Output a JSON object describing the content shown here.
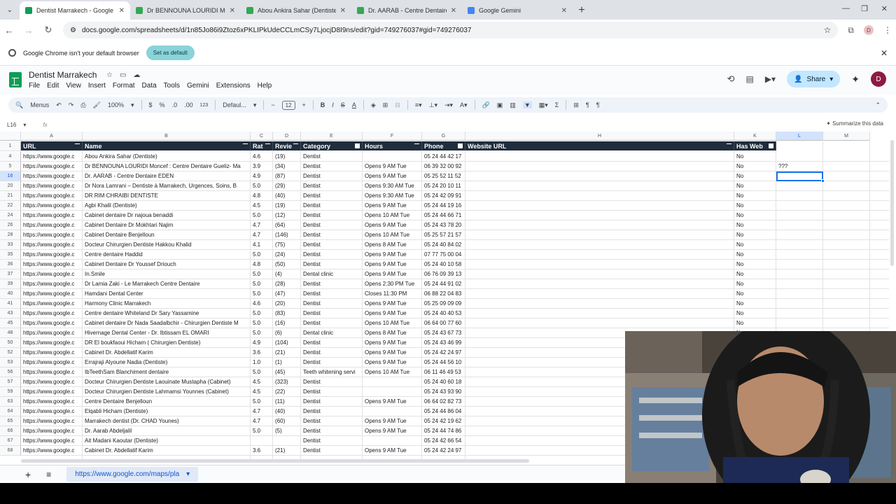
{
  "browser": {
    "tabs": [
      {
        "title": "Dentist Marrakech - Google Sh",
        "active": true,
        "favicon_color": "#0f9d58"
      },
      {
        "title": "Dr BENNOUNA LOURIDI Monc",
        "active": false,
        "favicon_color": "#34a853"
      },
      {
        "title": "Abou Ankira Sahar (Dentiste) -",
        "active": false,
        "favicon_color": "#34a853"
      },
      {
        "title": "Dr. AARAB - Centre Dentaire EI",
        "active": false,
        "favicon_color": "#34a853"
      },
      {
        "title": "Google Gemini",
        "active": false,
        "favicon_color": "#4285f4"
      }
    ],
    "url": "docs.google.com/spreadsheets/d/1n85Jo86i9Ztoz6xPKLIPkUdeCCLmCSy7LjocjD8I9ns/edit?gid=749276037#gid=749276037",
    "profile_initial": "D",
    "infobar": {
      "message": "Google Chrome isn't your default browser",
      "button": "Set as default"
    }
  },
  "sheets": {
    "title": "Dentist Marrakech",
    "menu": [
      "File",
      "Edit",
      "View",
      "Insert",
      "Format",
      "Data",
      "Tools",
      "Gemini",
      "Extensions",
      "Help"
    ],
    "share_label": "Share",
    "avatar_initial": "D",
    "toolbar": {
      "menus_label": "Menus",
      "zoom": "100%",
      "currency": "$",
      "percent": "%",
      "dec_less": ".0",
      "dec_more": ".00",
      "number_format": "123",
      "font": "Defaul...",
      "font_size": "12"
    },
    "name_box": "L16",
    "fx": "fx",
    "summarize_label": "Summarize this data",
    "columns": [
      {
        "letter": "A"
      },
      {
        "letter": "B"
      },
      {
        "letter": "C"
      },
      {
        "letter": "D"
      },
      {
        "letter": "E"
      },
      {
        "letter": "F"
      },
      {
        "letter": "G"
      },
      {
        "letter": "H"
      },
      {
        "letter": "K"
      },
      {
        "letter": "L"
      },
      {
        "letter": "M"
      }
    ],
    "header_row_number": "1",
    "headers": [
      "URL",
      "Name",
      "Rat",
      "Revie",
      "Category",
      "Hours",
      "Phone",
      "Website URL",
      "Has Web"
    ],
    "rows": [
      {
        "n": "4",
        "url": "https://www.google.c",
        "name": "Abou Ankira Sahar (Dentiste)",
        "rating": "4.6",
        "reviews": "(19)",
        "category": "Dentist",
        "hours": "",
        "phone": "05 24 44 42 17",
        "has_web": "No",
        "l": ""
      },
      {
        "n": "5",
        "url": "https://www.google.c",
        "name": "Dr BENNOUNA LOURIDI Moncef : Centre Dentaire Gueliz- Ma",
        "rating": "3.9",
        "reviews": "(34)",
        "category": "Dentist",
        "hours": "Opens 9 AM Tue",
        "phone": "06 39 32 00 92",
        "has_web": "No",
        "l": "???"
      },
      {
        "n": "16",
        "url": "https://www.google.c",
        "name": "Dr. AARAB - Centre Dentaire EDEN",
        "rating": "4.9",
        "reviews": "(87)",
        "category": "Dentist",
        "hours": "Opens 9 AM Tue",
        "phone": "05 25 52 11 52",
        "has_web": "No",
        "l": ""
      },
      {
        "n": "20",
        "url": "https://www.google.c",
        "name": "Dr Nora Lamrani – Dentiste à Marrakech, Urgences, Soins, B",
        "rating": "5.0",
        "reviews": "(29)",
        "category": "Dentist",
        "hours": "Opens 9:30 AM Tue",
        "phone": "05 24 20 10 11",
        "has_web": "No",
        "l": ""
      },
      {
        "n": "21",
        "url": "https://www.google.c",
        "name": "DR RIM CHRAIBI DENTISTE",
        "rating": "4.8",
        "reviews": "(40)",
        "category": "Dentist",
        "hours": "Opens 9:30 AM Tue",
        "phone": "05 24 42 09 91",
        "has_web": "No",
        "l": ""
      },
      {
        "n": "22",
        "url": "https://www.google.c",
        "name": "Agbi Khalil (Dentiste)",
        "rating": "4.5",
        "reviews": "(19)",
        "category": "Dentist",
        "hours": "Opens 9 AM Tue",
        "phone": "05 24 44 19 16",
        "has_web": "No",
        "l": ""
      },
      {
        "n": "24",
        "url": "https://www.google.c",
        "name": "Cabinet dentaire Dr najoua benaddi",
        "rating": "5.0",
        "reviews": "(12)",
        "category": "Dentist",
        "hours": "Opens 10 AM Tue",
        "phone": "05 24 44 66 71",
        "has_web": "No",
        "l": ""
      },
      {
        "n": "26",
        "url": "https://www.google.c",
        "name": "Cabinet Dentaire Dr Mokhtari Najim",
        "rating": "4.7",
        "reviews": "(64)",
        "category": "Dentist",
        "hours": "Opens 9 AM Tue",
        "phone": "05 24 43 78 20",
        "has_web": "No",
        "l": ""
      },
      {
        "n": "28",
        "url": "https://www.google.c",
        "name": "Cabinet Dentaire Benjelloun",
        "rating": "4.7",
        "reviews": "(146)",
        "category": "Dentist",
        "hours": "Opens 10 AM Tue",
        "phone": "05 25 57 21 57",
        "has_web": "No",
        "l": ""
      },
      {
        "n": "33",
        "url": "https://www.google.c",
        "name": "Docteur Chirurgien Dentiste Hakkou Khalid",
        "rating": "4.1",
        "reviews": "(75)",
        "category": "Dentist",
        "hours": "Opens 8 AM Tue",
        "phone": "05 24 40 84 02",
        "has_web": "No",
        "l": ""
      },
      {
        "n": "35",
        "url": "https://www.google.c",
        "name": "Centre dentaire Haddid",
        "rating": "5.0",
        "reviews": "(24)",
        "category": "Dentist",
        "hours": "Opens 9 AM Tue",
        "phone": "07 77 75 00 04",
        "has_web": "No",
        "l": ""
      },
      {
        "n": "36",
        "url": "https://www.google.c",
        "name": "Cabinet Dentaire Dr Youssef Driouch",
        "rating": "4.8",
        "reviews": "(50)",
        "category": "Dentist",
        "hours": "Opens 9 AM Tue",
        "phone": "05 24 40 10 58",
        "has_web": "No",
        "l": ""
      },
      {
        "n": "37",
        "url": "https://www.google.c",
        "name": "In.Smile",
        "rating": "5.0",
        "reviews": "(4)",
        "category": "Dental clinic",
        "hours": "Opens 9 AM Tue",
        "phone": "06 76 09 39 13",
        "has_web": "No",
        "l": ""
      },
      {
        "n": "39",
        "url": "https://www.google.c",
        "name": "Dr Lamia Zaki - Le Marrakech Centre Dentaire",
        "rating": "5.0",
        "reviews": "(28)",
        "category": "Dentist",
        "hours": "Opens 2:30 PM Tue",
        "phone": "05 24 44 91 02",
        "has_web": "No",
        "l": ""
      },
      {
        "n": "40",
        "url": "https://www.google.c",
        "name": "Hamdani Dental Center",
        "rating": "5.0",
        "reviews": "(47)",
        "category": "Dentist",
        "hours": "Closes 11:30 PM",
        "phone": "06 88 22 04 83",
        "has_web": "No",
        "l": ""
      },
      {
        "n": "41",
        "url": "https://www.google.c",
        "name": "Harmony Clinic Marrakech",
        "rating": "4.6",
        "reviews": "(20)",
        "category": "Dentist",
        "hours": "Opens 9 AM Tue",
        "phone": "05 25 09 09 09",
        "has_web": "No",
        "l": ""
      },
      {
        "n": "43",
        "url": "https://www.google.c",
        "name": "Centre dentaire Whiteland Dr Sary Yassamine",
        "rating": "5.0",
        "reviews": "(83)",
        "category": "Dentist",
        "hours": "Opens 9 AM Tue",
        "phone": "05 24 40 40 53",
        "has_web": "No",
        "l": ""
      },
      {
        "n": "45",
        "url": "https://www.google.c",
        "name": "Cabinet dentaire Dr Nada Saadalbchir - Chirurgien Dentiste M",
        "rating": "5.0",
        "reviews": "(16)",
        "category": "Dentist",
        "hours": "Opens 10 AM Tue",
        "phone": "06 64 00 77 60",
        "has_web": "No",
        "l": ""
      },
      {
        "n": "48",
        "url": "https://www.google.c",
        "name": "Hivernage Dental Center - Dr. Ibtissam EL OMARI",
        "rating": "5.0",
        "reviews": "(6)",
        "category": "Dental clinic",
        "hours": "Opens 8 AM Tue",
        "phone": "05 24 43 67 73",
        "has_web": "No",
        "l": ""
      },
      {
        "n": "50",
        "url": "https://www.google.c",
        "name": "DR El boukfaoui Hicham ( Chirurgien Dentiste)",
        "rating": "4.9",
        "reviews": "(104)",
        "category": "Dentist",
        "hours": "Opens 9 AM Tue",
        "phone": "05 24 43 46 99",
        "has_web": "",
        "l": ""
      },
      {
        "n": "52",
        "url": "https://www.google.c",
        "name": "Cabinet Dr. Abdellatif Karim",
        "rating": "3.6",
        "reviews": "(21)",
        "category": "Dentist",
        "hours": "Opens 9 AM Tue",
        "phone": "05 24 42 24 97",
        "has_web": "",
        "l": ""
      },
      {
        "n": "53",
        "url": "https://www.google.c",
        "name": "Errajraji Alyoune Nadia (Dentiste)",
        "rating": "1.0",
        "reviews": "(1)",
        "category": "Dentist",
        "hours": "Opens 9 AM Tue",
        "phone": "05 24 44 56 10",
        "has_web": "",
        "l": ""
      },
      {
        "n": "56",
        "url": "https://www.google.c",
        "name": "IbTeethSam Blanchiment dentaire",
        "rating": "5.0",
        "reviews": "(45)",
        "category": "Teeth whitening servi",
        "hours": "Opens 10 AM Tue",
        "phone": "06 11 46 49 53",
        "has_web": "",
        "l": ""
      },
      {
        "n": "57",
        "url": "https://www.google.c",
        "name": "Docteur Chirurgien Dentiste Laouinate Mustapha (Cabinet)",
        "rating": "4.5",
        "reviews": "(323)",
        "category": "Dentist",
        "hours": "",
        "phone": "05 24 40 60 18",
        "has_web": "",
        "l": ""
      },
      {
        "n": "59",
        "url": "https://www.google.c",
        "name": "Docteur Chirurgien Dentiste Lahmamsi Younnes (Cabinet)",
        "rating": "4.5",
        "reviews": "(22)",
        "category": "Dentist",
        "hours": "",
        "phone": "05 24 43 93 90",
        "has_web": "",
        "l": ""
      },
      {
        "n": "63",
        "url": "https://www.google.c",
        "name": "Centre Dentaire Benjelloun",
        "rating": "5.0",
        "reviews": "(11)",
        "category": "Dentist",
        "hours": "Opens 9 AM Tue",
        "phone": "06 64 02 82 73",
        "has_web": "",
        "l": ""
      },
      {
        "n": "64",
        "url": "https://www.google.c",
        "name": "Elqabli Hicham (Dentiste)",
        "rating": "4.7",
        "reviews": "(40)",
        "category": "Dentist",
        "hours": "",
        "phone": "05 24 44 86 04",
        "has_web": "",
        "l": ""
      },
      {
        "n": "65",
        "url": "https://www.google.c",
        "name": "Marrakech dentist (Dr. CHAD Younes)",
        "rating": "4.7",
        "reviews": "(60)",
        "category": "Dentist",
        "hours": "Opens 9 AM Tue",
        "phone": "05 24 42 19 62",
        "has_web": "",
        "l": ""
      },
      {
        "n": "66",
        "url": "https://www.google.c",
        "name": "Dr. Aarab Abdeljalil",
        "rating": "5.0",
        "reviews": "(5)",
        "category": "Dentist",
        "hours": "Opens 9 AM Tue",
        "phone": "05 24 44 74 86",
        "has_web": "",
        "l": ""
      },
      {
        "n": "67",
        "url": "https://www.google.c",
        "name": "Ait Madani Kaoutar (Dentiste)",
        "rating": "",
        "reviews": "",
        "category": "Dentist",
        "hours": "",
        "phone": "05 24 42 66 54",
        "has_web": "",
        "l": ""
      },
      {
        "n": "68",
        "url": "https://www.google.c",
        "name": "Cabinet Dr. Abdellatif Karim",
        "rating": "3.6",
        "reviews": "(21)",
        "category": "Dentist",
        "hours": "Opens 9 AM Tue",
        "phone": "05 24 42 24 97",
        "has_web": "",
        "l": ""
      }
    ],
    "sheet_tab": "https://www.google.com/maps/pla"
  },
  "colors": {
    "header_bg": "#1f2d3d",
    "selection": "#1a73e8",
    "sheets_green": "#0f9d58"
  }
}
